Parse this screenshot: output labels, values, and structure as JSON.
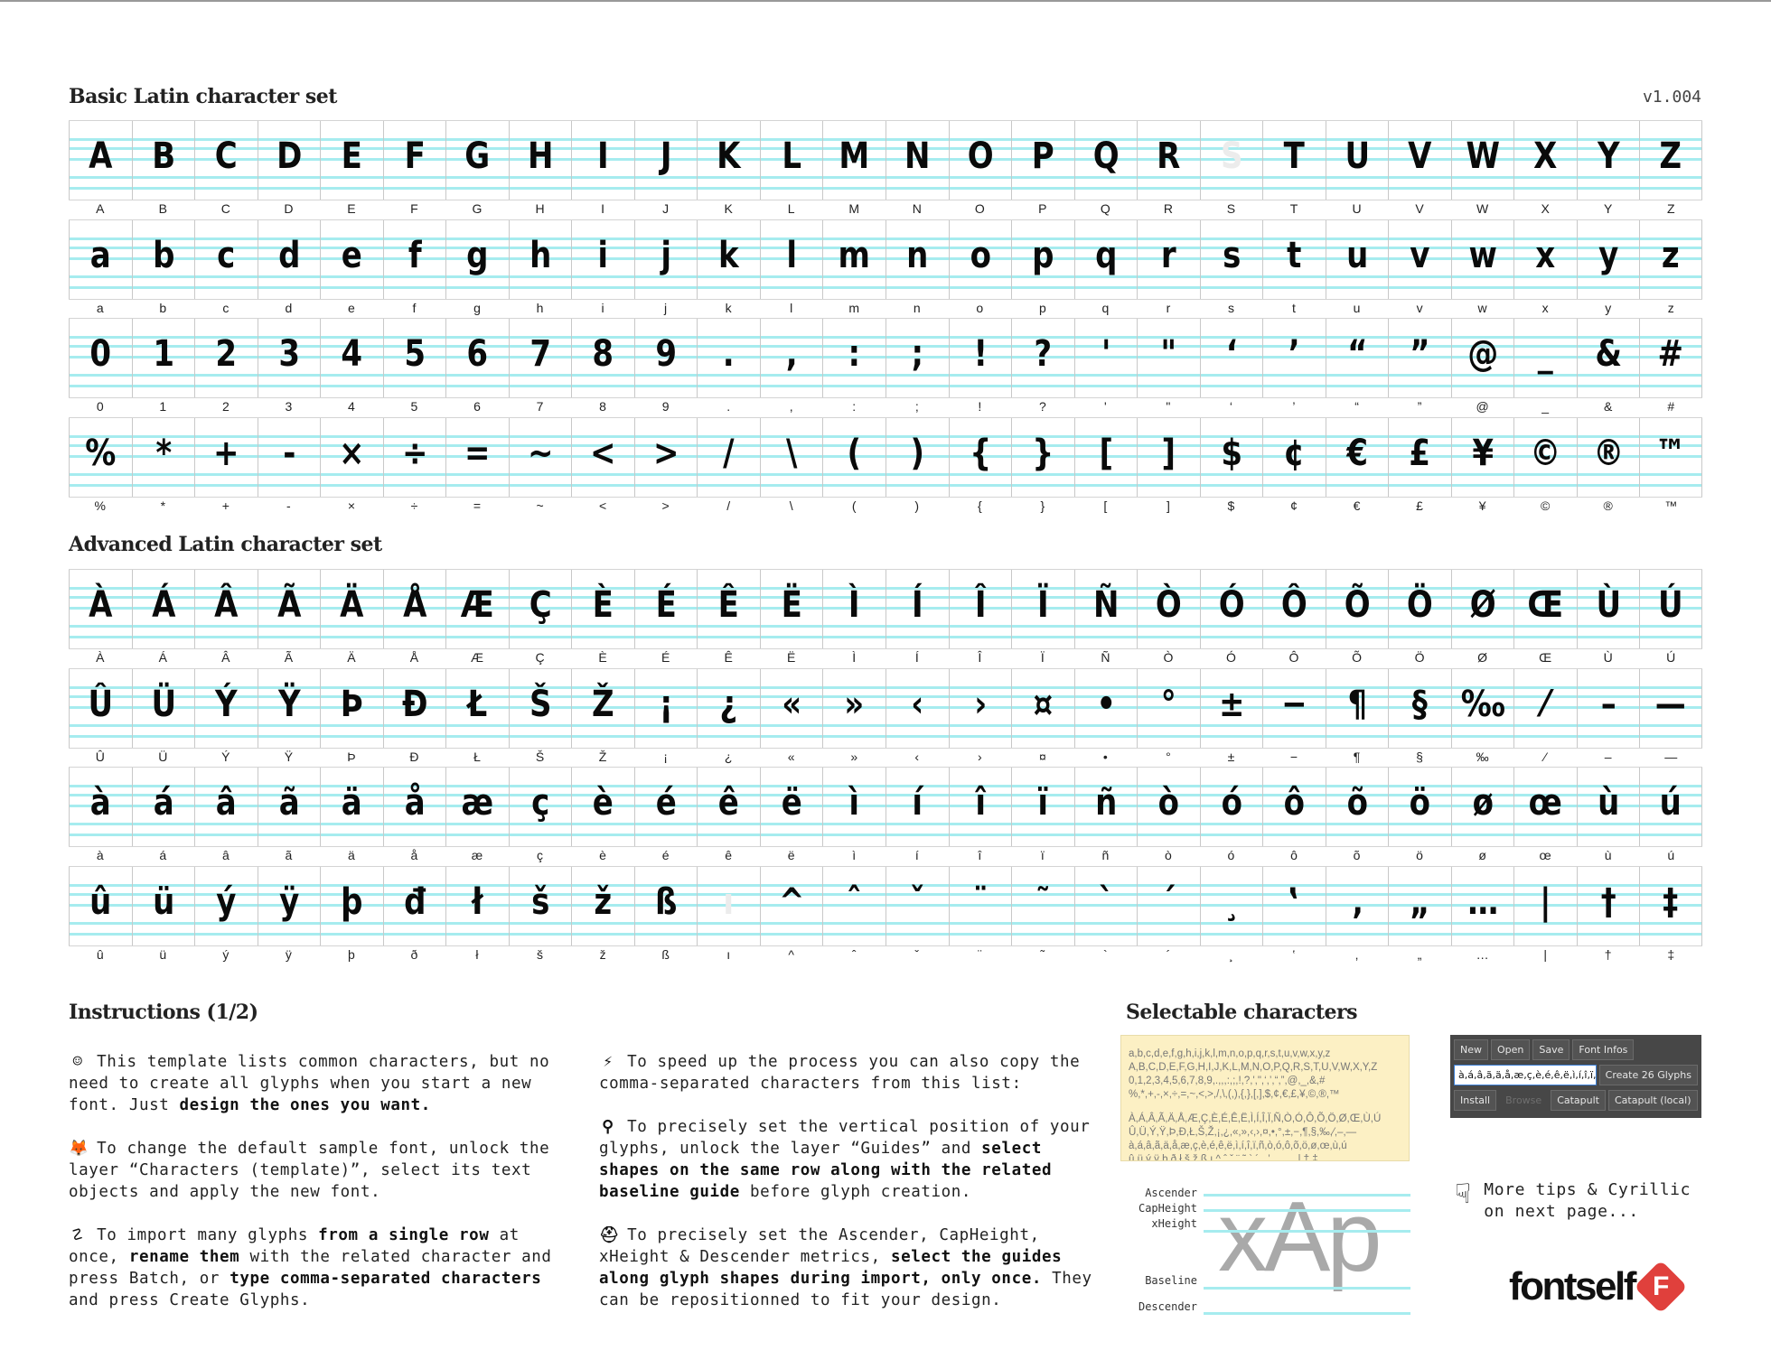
{
  "basic": {
    "title": "Basic Latin character set",
    "version": "v1.004",
    "rows": [
      {
        "glyphs": [
          "A",
          "B",
          "C",
          "D",
          "E",
          "F",
          "G",
          "H",
          "I",
          "J",
          "K",
          "L",
          "M",
          "N",
          "O",
          "P",
          "Q",
          "R",
          "S",
          "T",
          "U",
          "V",
          "W",
          "X",
          "Y",
          "Z"
        ],
        "labels": [
          "A",
          "B",
          "C",
          "D",
          "E",
          "F",
          "G",
          "H",
          "I",
          "J",
          "K",
          "L",
          "M",
          "N",
          "O",
          "P",
          "Q",
          "R",
          "S",
          "T",
          "U",
          "V",
          "W",
          "X",
          "Y",
          "Z"
        ],
        "faded": [
          18
        ]
      },
      {
        "glyphs": [
          "a",
          "b",
          "c",
          "d",
          "e",
          "f",
          "g",
          "h",
          "i",
          "j",
          "k",
          "l",
          "m",
          "n",
          "o",
          "p",
          "q",
          "r",
          "s",
          "t",
          "u",
          "v",
          "w",
          "x",
          "y",
          "z"
        ],
        "labels": [
          "a",
          "b",
          "c",
          "d",
          "e",
          "f",
          "g",
          "h",
          "i",
          "j",
          "k",
          "l",
          "m",
          "n",
          "o",
          "p",
          "q",
          "r",
          "s",
          "t",
          "u",
          "v",
          "w",
          "x",
          "y",
          "z"
        ],
        "faded": []
      },
      {
        "glyphs": [
          "0",
          "1",
          "2",
          "3",
          "4",
          "5",
          "6",
          "7",
          "8",
          "9",
          ".",
          ",",
          ":",
          ";",
          "!",
          "?",
          "'",
          "\"",
          "‘",
          "’",
          "“",
          "”",
          "@",
          "_",
          "&",
          "#"
        ],
        "labels": [
          "0",
          "1",
          "2",
          "3",
          "4",
          "5",
          "6",
          "7",
          "8",
          "9",
          ".",
          ",",
          ":",
          ";",
          "!",
          "?",
          "'",
          "\"",
          "‘",
          "’",
          "“",
          "”",
          "@",
          "_",
          "&",
          "#"
        ],
        "faded": []
      },
      {
        "glyphs": [
          "%",
          "*",
          "+",
          "-",
          "×",
          "÷",
          "=",
          "~",
          "<",
          ">",
          "/",
          "\\",
          "(",
          ")",
          "{",
          "}",
          "[",
          "]",
          "$",
          "¢",
          "€",
          "£",
          "¥",
          "©",
          "®",
          "™"
        ],
        "labels": [
          "%",
          "*",
          "+",
          "-",
          "×",
          "÷",
          "=",
          "~",
          "<",
          ">",
          "/",
          "\\",
          "(",
          ")",
          "{",
          "}",
          "[",
          "]",
          "$",
          "¢",
          "€",
          "£",
          "¥",
          "©",
          "®",
          "™"
        ],
        "faded": []
      }
    ]
  },
  "advanced": {
    "title": "Advanced Latin character set",
    "rows": [
      {
        "glyphs": [
          "À",
          "Á",
          "Â",
          "Ã",
          "Ä",
          "Å",
          "Æ",
          "Ç",
          "È",
          "É",
          "Ê",
          "Ë",
          "Ì",
          "Í",
          "Î",
          "Ï",
          "Ñ",
          "Ò",
          "Ó",
          "Ô",
          "Õ",
          "Ö",
          "Ø",
          "Œ",
          "Ù",
          "Ú"
        ],
        "labels": [
          "À",
          "Á",
          "Â",
          "Ã",
          "Ä",
          "Å",
          "Æ",
          "Ç",
          "È",
          "É",
          "Ê",
          "Ë",
          "Ì",
          "Í",
          "Î",
          "Ï",
          "Ñ",
          "Ò",
          "Ó",
          "Ô",
          "Õ",
          "Ö",
          "Ø",
          "Œ",
          "Ù",
          "Ú"
        ],
        "faded": []
      },
      {
        "glyphs": [
          "Û",
          "Ü",
          "Ý",
          "Ÿ",
          "Þ",
          "Đ",
          "Ł",
          "Š",
          "Ž",
          "¡",
          "¿",
          "«",
          "»",
          "‹",
          "›",
          "¤",
          "•",
          "°",
          "±",
          "−",
          "¶",
          "§",
          "‰",
          "⁄",
          "–",
          "—"
        ],
        "labels": [
          "Û",
          "Ü",
          "Ý",
          "Ÿ",
          "Þ",
          "Đ",
          "Ł",
          "Š",
          "Ž",
          "¡",
          "¿",
          "«",
          "»",
          "‹",
          "›",
          "¤",
          "•",
          "°",
          "±",
          "−",
          "¶",
          "§",
          "‰",
          "⁄",
          "–",
          "—"
        ],
        "faded": []
      },
      {
        "glyphs": [
          "à",
          "á",
          "â",
          "ã",
          "ä",
          "å",
          "æ",
          "ç",
          "è",
          "é",
          "ê",
          "ë",
          "ì",
          "í",
          "î",
          "ï",
          "ñ",
          "ò",
          "ó",
          "ô",
          "õ",
          "ö",
          "ø",
          "œ",
          "ù",
          "ú"
        ],
        "labels": [
          "à",
          "á",
          "â",
          "ã",
          "ä",
          "å",
          "æ",
          "ç",
          "è",
          "é",
          "ê",
          "ë",
          "ì",
          "í",
          "î",
          "ï",
          "ñ",
          "ò",
          "ó",
          "ô",
          "õ",
          "ö",
          "ø",
          "œ",
          "ù",
          "ú"
        ],
        "faded": []
      },
      {
        "glyphs": [
          "û",
          "ü",
          "ý",
          "ÿ",
          "þ",
          "đ",
          "ł",
          "š",
          "ž",
          "ß",
          "ı",
          "^",
          "ˆ",
          "ˇ",
          "¨",
          "˜",
          "`",
          "´",
          "¸",
          "‛",
          "‚",
          "„",
          "…",
          "|",
          "†",
          "‡"
        ],
        "labels": [
          "û",
          "ü",
          "ý",
          "ÿ",
          "þ",
          "ð",
          "ł",
          "š",
          "ž",
          "ß",
          "ı",
          "^",
          "ˆ",
          "ˇ",
          "¨",
          "˜",
          "`",
          "´",
          "¸",
          "‛",
          "‚",
          "„",
          "…",
          "|",
          "†",
          "‡"
        ],
        "faded": [
          10
        ]
      }
    ]
  },
  "instructions": {
    "title": "Instructions (1/2)",
    "col1": [
      {
        "icon": "☺",
        "icon_name": "smiley-icon",
        "parts": [
          {
            "t": "This template lists common characters, but no need to create all glyphs when you start a new font. Just ",
            "b": false
          },
          {
            "t": "design the ones you want.",
            "b": true
          }
        ]
      },
      {
        "icon": "🦊",
        "icon_name": "fox-icon",
        "parts": [
          {
            "t": "To change the default sample font, unlock the layer “Characters (template)”, select its text objects and apply the new font.",
            "b": false
          }
        ]
      },
      {
        "icon": "☡",
        "icon_name": "wave-icon",
        "parts": [
          {
            "t": "To import many glyphs ",
            "b": false
          },
          {
            "t": "from a single row",
            "b": true
          },
          {
            "t": " at once, ",
            "b": false
          },
          {
            "t": "rename them",
            "b": true
          },
          {
            "t": " with the related character and press Batch, or ",
            "b": false
          },
          {
            "t": "type comma-separated characters",
            "b": true
          },
          {
            "t": " and press Create Glyphs.",
            "b": false
          }
        ]
      }
    ],
    "col2": [
      {
        "icon": "⚡",
        "icon_name": "lightning-icon",
        "parts": [
          {
            "t": "To speed up the process you can also copy the comma-separated characters from this list:",
            "b": false
          }
        ]
      },
      {
        "icon": "⚲",
        "icon_name": "magnifier-icon",
        "parts": [
          {
            "t": "To precisely set the vertical position of your glyphs, unlock the layer “Guides” and ",
            "b": false
          },
          {
            "t": "select shapes on the same row along with the related baseline guide",
            "b": true
          },
          {
            "t": " before glyph creation.",
            "b": false
          }
        ]
      },
      {
        "icon": "⛑",
        "icon_name": "hardhat-icon",
        "parts": [
          {
            "t": "To precisely set the Ascender, CapHeight, xHeight & Descender metrics, ",
            "b": false
          },
          {
            "t": "select the guides along glyph shapes during import, only once.",
            "b": true
          },
          {
            "t": " They can be repositionned to fit your design.",
            "b": false
          }
        ]
      }
    ]
  },
  "selectable": {
    "title": "Selectable characters",
    "lines": [
      "a,b,c,d,e,f,g,h,i,j,k,l,m,n,o,p,q,r,s,t,u,v,w,x,y,z",
      "A,B,C,D,E,F,G,H,I,J,K,L,M,N,O,P,Q,R,S,T,U,V,W,X,Y,Z",
      "0,1,2,3,4,5,6,7,8,9,.,,,:,;,!,?,',\",‘,’,“,”,@,_,&,#",
      "%,*,+,-,×,÷,=,~,<,>,/,\\,(,),{,},[,],$,¢,€,£,¥,©,®,™",
      "",
      "À,Á,Â,Ã,Ä,Å,Æ,Ç,È,É,Ê,Ë,Ì,Í,Î,Ï,Ñ,Ò,Ó,Ô,Õ,Ö,Ø,Œ,Ù,Ú",
      "Û,Ü,Ý,Ÿ,Þ,Đ,Ł,Š,Ž,¡,¿,«,»,‹,›,¤,•,°,±,−,¶,§,‰,⁄,–,—",
      "à,á,â,ã,ä,å,æ,ç,è,é,ê,ë,ì,í,î,ï,ñ,ò,ó,ô,õ,ö,ø,œ,ù,ú",
      "û,ü,ý,ÿ,þ,ð,ł,š,ž,ß,ı,^,ˆ,ˇ,¨,˜,`,´,¸,‛,‚,„,…,|,†,‡"
    ]
  },
  "metrics": {
    "labels": {
      "ascender": "Ascender",
      "capheight": "CapHeight",
      "xheight": "xHeight",
      "baseline": "Baseline",
      "descender": "Descender"
    },
    "sample": "xAp"
  },
  "panel": {
    "buttons_row1": [
      "New",
      "Open",
      "Save",
      "Font Infos"
    ],
    "input_value": "à,á,â,ã,ä,å,æ,ç,è,é,ê,ë,ì,í,î,ï,ñ,ò,ó,ô,õ,ö,ø,œ,ù,ú",
    "create_button": "Create 26 Glyphs",
    "buttons_row3": [
      "Install",
      "Browse",
      "Catapult",
      "Catapult (local)"
    ],
    "disabled": [
      "Browse"
    ]
  },
  "tips": {
    "icon": "☟",
    "line1": "More tips & Cyrillic",
    "line2": "on next page..."
  },
  "brand": {
    "name": "fontself",
    "mark": "F",
    "accent": "#e0403c"
  },
  "colors": {
    "guide": "#a6ecef",
    "selectable_bg": "#fcf0c4",
    "panel_bg": "#474747"
  }
}
